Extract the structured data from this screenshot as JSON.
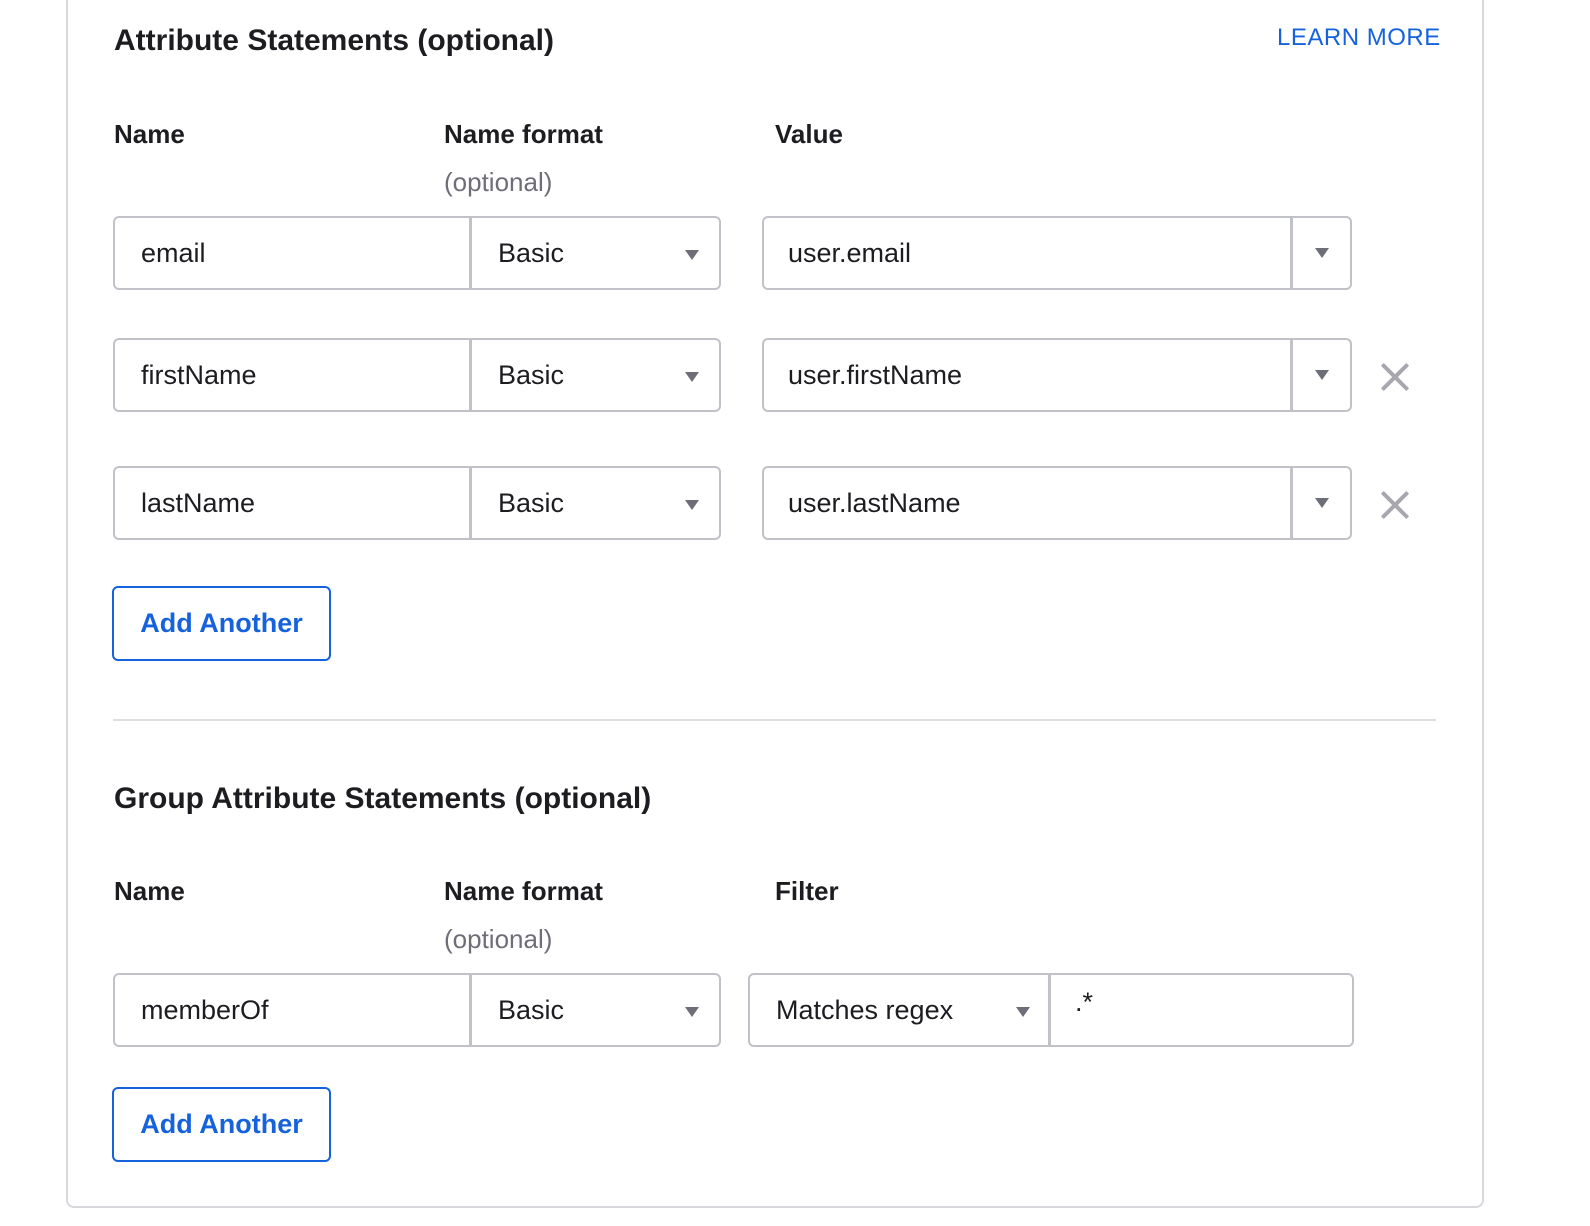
{
  "attributes": {
    "title": "Attribute Statements (optional)",
    "learn_more": "LEARN MORE",
    "columns": {
      "name": "Name",
      "name_format": "Name format",
      "name_format_sub": "(optional)",
      "value": "Value"
    },
    "rows": [
      {
        "name": "email",
        "format": "Basic",
        "value": "user.email"
      },
      {
        "name": "firstName",
        "format": "Basic",
        "value": "user.firstName"
      },
      {
        "name": "lastName",
        "format": "Basic",
        "value": "user.lastName"
      }
    ],
    "add_another": "Add Another"
  },
  "group_attributes": {
    "title": "Group Attribute Statements (optional)",
    "columns": {
      "name": "Name",
      "name_format": "Name format",
      "name_format_sub": "(optional)",
      "filter": "Filter"
    },
    "rows": [
      {
        "name": "memberOf",
        "format": "Basic",
        "filter_type": "Matches regex",
        "filter_value": ".*"
      }
    ],
    "add_another": "Add Another"
  },
  "icons": {
    "dropdown": "caret-down-icon",
    "remove": "close-icon"
  }
}
